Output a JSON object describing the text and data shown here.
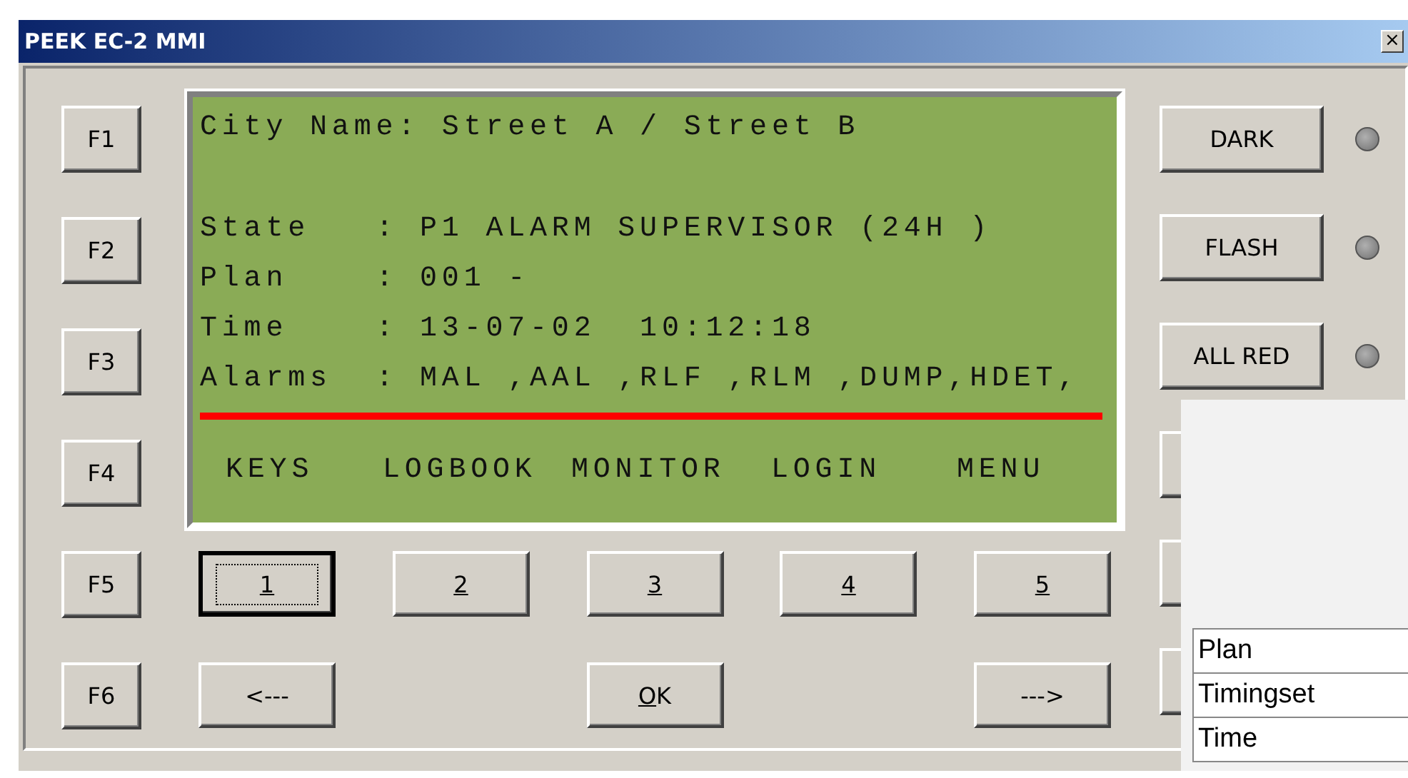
{
  "window": {
    "title": "PEEK EC-2 MMI",
    "close": "×"
  },
  "function_keys": [
    "F1",
    "F2",
    "F3",
    "F4",
    "F5",
    "F6"
  ],
  "display": {
    "header": "City Name: Street A / Street B",
    "lines": [
      "State   : P1 ALARM SUPERVISOR (24H )",
      "Plan    : 001 -",
      "Time    : 13-07-02  10:12:18",
      "Alarms  : MAL ,AAL ,RLF ,RLM ,DUMP,HDET,"
    ],
    "softkeys": [
      "KEYS",
      "LOGBOOK",
      "MONITOR",
      "LOGIN",
      "MENU"
    ]
  },
  "digit_buttons": [
    {
      "label": "1",
      "focused": true,
      "underline_first": true
    },
    {
      "label": "2",
      "focused": false,
      "underline_first": true
    },
    {
      "label": "3",
      "focused": false,
      "underline_first": true
    },
    {
      "label": "4",
      "focused": false,
      "underline_first": true
    },
    {
      "label": "5",
      "focused": false,
      "underline_first": true
    }
  ],
  "nav_buttons": [
    {
      "label": "<---",
      "underline_first": false
    },
    {
      "label": "OK",
      "underline_first": true
    },
    {
      "label": "--->",
      "underline_first": false
    }
  ],
  "mode_buttons": [
    {
      "label": "DARK",
      "lit": false
    },
    {
      "label": "FLASH",
      "lit": false
    },
    {
      "label": "ALL RED",
      "lit": false
    }
  ],
  "overlay": {
    "rows": [
      "Plan",
      "Timingset",
      "Time"
    ]
  }
}
